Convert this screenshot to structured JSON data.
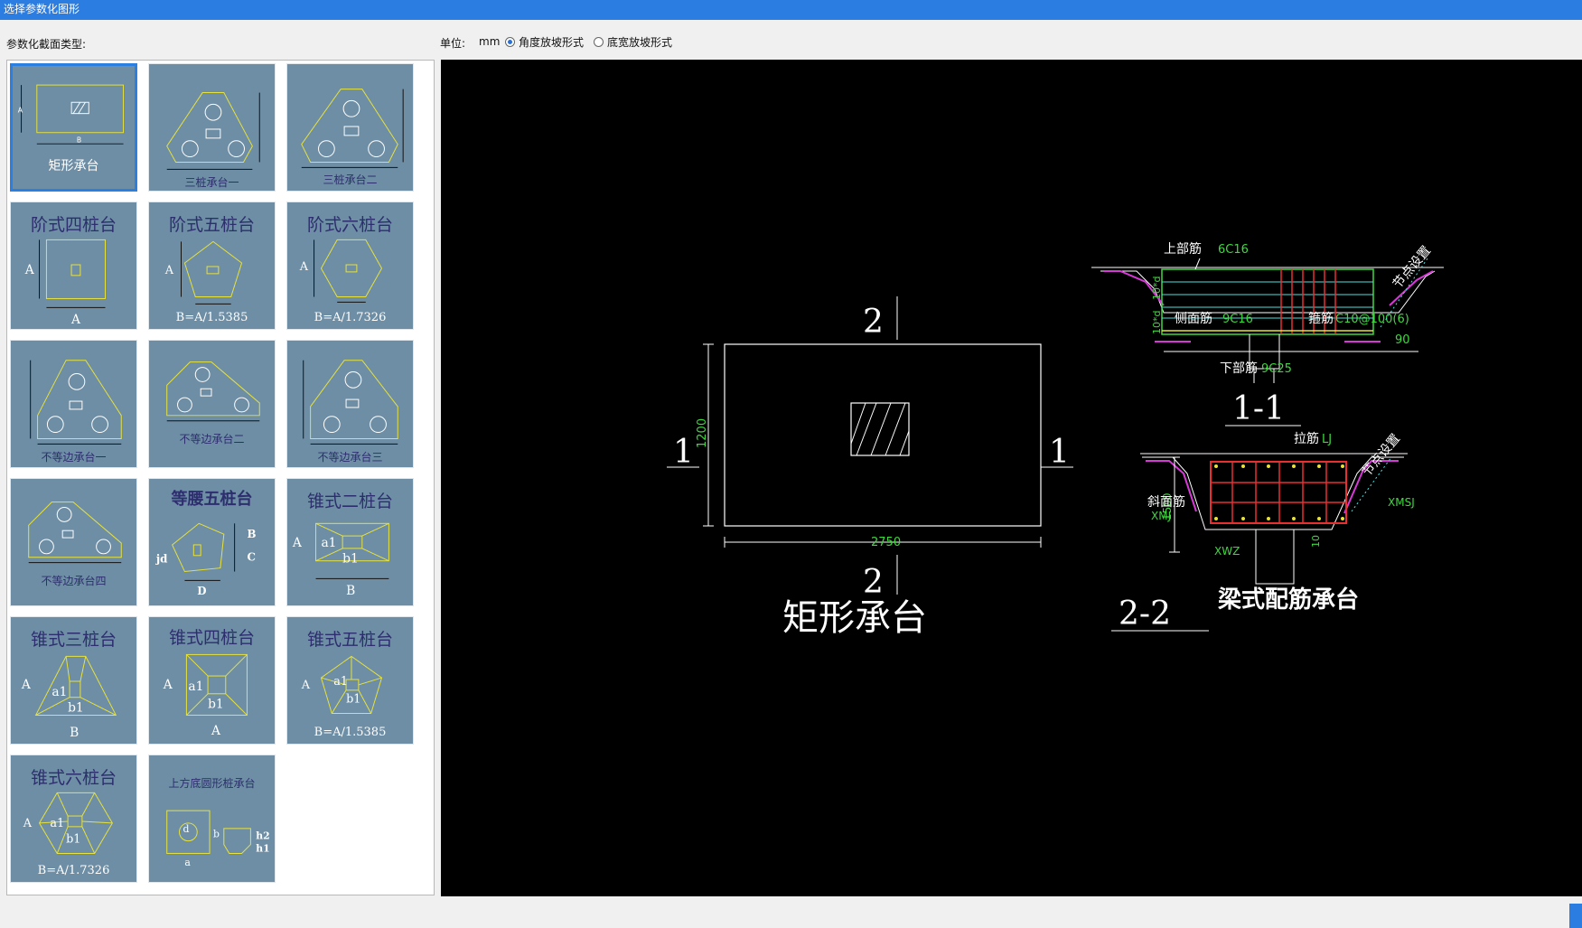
{
  "window": {
    "title": "选择参数化图形"
  },
  "left": {
    "label": "参数化截面类型:"
  },
  "units": {
    "label": "单位:",
    "value": "mm"
  },
  "radios": [
    {
      "label": "角度放坡形式",
      "checked": true
    },
    {
      "label": "底宽放坡形式",
      "checked": false
    }
  ],
  "tiles": [
    {
      "title": "",
      "caption": "矩形承台",
      "selected": true
    },
    {
      "title": "",
      "caption": "三桩承台一"
    },
    {
      "title": "",
      "caption": "三桩承台二"
    },
    {
      "title": "阶式四桩台",
      "caption": ""
    },
    {
      "title": "阶式五桩台",
      "caption": "B=A/1.5385"
    },
    {
      "title": "阶式六桩台",
      "caption": "B=A/1.7326"
    },
    {
      "title": "",
      "caption": "不等边承台一"
    },
    {
      "title": "",
      "caption": "不等边承台二"
    },
    {
      "title": "",
      "caption": "不等边承台三"
    },
    {
      "title": "",
      "caption": "不等边承台四"
    },
    {
      "title": "等腰五桩台",
      "caption": ""
    },
    {
      "title": "锥式二桩台",
      "caption": ""
    },
    {
      "title": "锥式三桩台",
      "caption": ""
    },
    {
      "title": "锥式四桩台",
      "caption": ""
    },
    {
      "title": "锥式五桩台",
      "caption": "B=A/1.5385"
    },
    {
      "title": "锥式六桩台",
      "caption": "B=A/1.7326"
    },
    {
      "title": "上方底圆形桩承台",
      "caption": ""
    }
  ],
  "preview": {
    "section_mark_top": "2",
    "section_mark_bottom": "2",
    "section_mark_left": "1",
    "section_mark_right": "1",
    "dim_height": "1200",
    "dim_width": "2750",
    "name": "矩形承台",
    "top_rebar_label": "上部筋",
    "top_rebar_value": "6C16",
    "side_rebar_label": "侧面筋",
    "side_rebar_value": "9C16",
    "stirrup_label": "箍筋",
    "stirrup_value": "C10@100(6)",
    "bottom_rebar_label": "下部筋",
    "bottom_rebar_value": "9C25",
    "node_label": "节点设置",
    "angle": "90",
    "ten_d": "10*d",
    "section_11": "1-1",
    "tie_label": "拉筋",
    "tie_value": "LJ",
    "slope_label": "斜面筋",
    "slope_value": "XMJ",
    "dim_1500": "1500",
    "xwz": "XWZ",
    "xmsj": "XMSJ",
    "ten": "10",
    "section_22": "2-2",
    "beam_title": "梁式配筋承台"
  }
}
